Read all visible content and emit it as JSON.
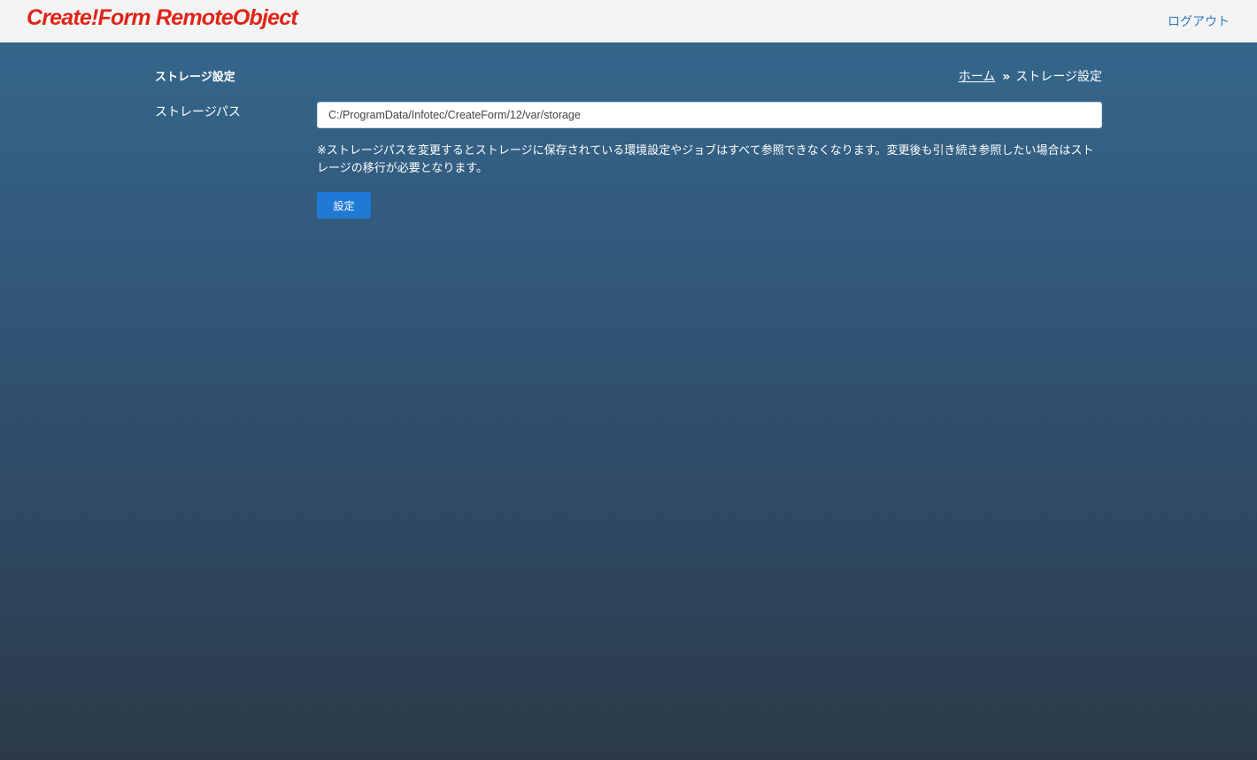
{
  "header": {
    "logo_text": "Create!Form RemoteObject",
    "logout_label": "ログアウト"
  },
  "page": {
    "title": "ストレージ設定"
  },
  "breadcrumb": {
    "home_label": "ホーム",
    "separator": "»",
    "current_label": "ストレージ設定"
  },
  "form": {
    "storage_path_label": "ストレージパス",
    "storage_path_value": "C:/ProgramData/Infotec/CreateForm/12/var/storage",
    "note": "※ストレージパスを変更するとストレージに保存されている環境設定やジョブはすべて参照できなくなります。変更後も引き続き参照したい場合はストレージの移行が必要となります。",
    "submit_label": "設定"
  },
  "colors": {
    "logo": "#e02418",
    "link": "#2f7ac3",
    "button": "#1f7ad6"
  }
}
